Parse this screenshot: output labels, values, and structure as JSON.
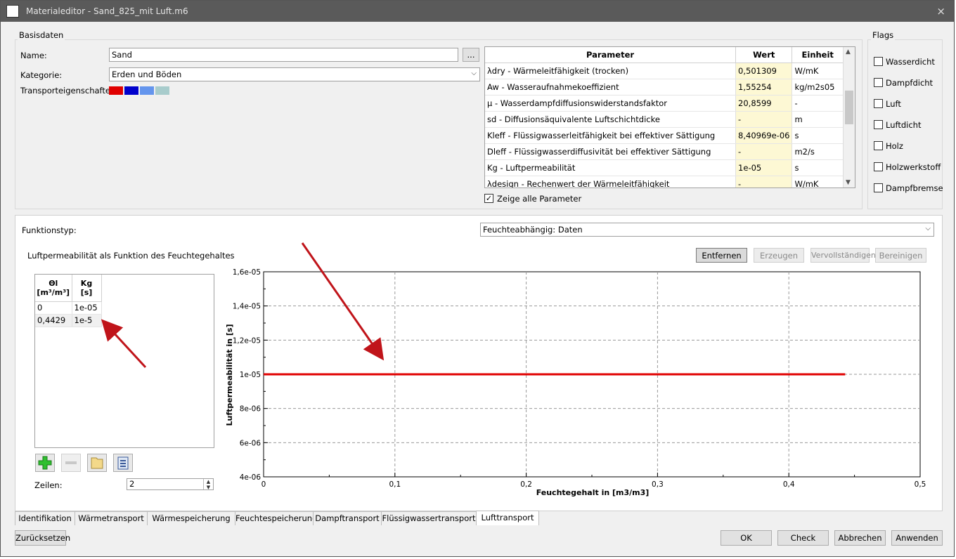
{
  "window": {
    "title": "Materialeditor - Sand_825_mit Luft.m6",
    "close_glyph": "×"
  },
  "basisdaten": {
    "legend": "Basisdaten",
    "name_label": "Name:",
    "name_value": "Sand",
    "browse_label": "...",
    "kategorie_label": "Kategorie:",
    "kategorie_value": "Erden und Böden",
    "transport_label": "Transporteigenschaften:",
    "transport_colors": [
      "#e00000",
      "#0000cc",
      "#6495ed",
      "#a8cccc"
    ]
  },
  "parameters": {
    "headers": [
      "Parameter",
      "Wert",
      "Einheit"
    ],
    "rows": [
      {
        "param": "λdry - Wärmeleitfähigkeit (trocken)",
        "wert": "0,501309",
        "einheit": "W/mK"
      },
      {
        "param": "Aw - Wasseraufnahmekoeffizient",
        "wert": "1,55254",
        "einheit": "kg/m2s05"
      },
      {
        "param": "μ - Wasserdampfdiffusionswiderstandsfaktor",
        "wert": "20,8599",
        "einheit": "-"
      },
      {
        "param": "sd - Diffusionsäquivalente Luftschichtdicke",
        "wert": "-",
        "einheit": "m"
      },
      {
        "param": "Kleff - Flüssigwasserleitfähigkeit bei effektiver Sättigung",
        "wert": "8,40969e-06",
        "einheit": "s"
      },
      {
        "param": "Dleff - Flüssigwasserdiffusivität bei effektiver Sättigung",
        "wert": "-",
        "einheit": "m2/s"
      },
      {
        "param": "Kg - Luftpermeabilität",
        "wert": "1e-05",
        "einheit": "s"
      },
      {
        "param": "λdesign - Rechenwert der Wärmeleitfähigkeit",
        "wert": "-",
        "einheit": "W/mK"
      }
    ],
    "show_all_label": "Zeige alle Parameter",
    "show_all_checked": true
  },
  "flags": {
    "legend": "Flags",
    "items": [
      {
        "label": "Wasserdicht",
        "checked": false
      },
      {
        "label": "Dampfdicht",
        "checked": false
      },
      {
        "label": "Luft",
        "checked": false
      },
      {
        "label": "Luftdicht",
        "checked": false
      },
      {
        "label": "Holz",
        "checked": false
      },
      {
        "label": "Holzwerkstoff",
        "checked": false
      },
      {
        "label": "Dampfbremse",
        "checked": false
      }
    ]
  },
  "function": {
    "typ_label": "Funktionstyp:",
    "typ_value": "Feuchteabhängig: Daten",
    "subtitle": "Luftpermeabilität als Funktion des Feuchtegehaltes",
    "buttons": {
      "entfernen": "Entfernen",
      "erzeugen": "Erzeugen",
      "vervollstaendigen": "Vervollständigen",
      "bereinigen": "Bereinigen"
    },
    "table": {
      "col1_line1": "Θl",
      "col1_line2": "[m³/m³]",
      "col2_line1": "Kg",
      "col2_line2": "[s]",
      "rows": [
        {
          "theta": "0",
          "kg": "1e-05"
        },
        {
          "theta": "0,4429",
          "kg": "1e-5"
        }
      ]
    },
    "zeilen_label": "Zeilen:",
    "zeilen_value": "2"
  },
  "chart_data": {
    "type": "line",
    "title": "",
    "xlabel": "Feuchtegehalt in [m3/m3]",
    "ylabel": "Luftpermeabilität in [s]",
    "xlim": [
      0,
      0.5
    ],
    "ylim": [
      4e-06,
      1.6e-05
    ],
    "xticks": [
      "0",
      "0,1",
      "0,2",
      "0,3",
      "0,4",
      "0,5"
    ],
    "yticks": [
      "4e-06",
      "6e-06",
      "8e-06",
      "1e-05",
      "1,2e-05",
      "1,4e-05",
      "1,6e-05"
    ],
    "grid": true,
    "series": [
      {
        "x": [
          0,
          0.4429
        ],
        "y": [
          1e-05,
          1e-05
        ],
        "color": "#e00000"
      }
    ]
  },
  "tabs": {
    "items": [
      "Identifikation",
      "Wärmetransport",
      "Wärmespeicherung",
      "Feuchtespeicherung",
      "Dampftransport",
      "Flüssigwassertransport",
      "Lufttransport"
    ],
    "active": "Lufttransport"
  },
  "footer": {
    "reset": "Zurücksetzen",
    "ok": "OK",
    "check": "Check",
    "cancel": "Abbrechen",
    "apply": "Anwenden"
  }
}
